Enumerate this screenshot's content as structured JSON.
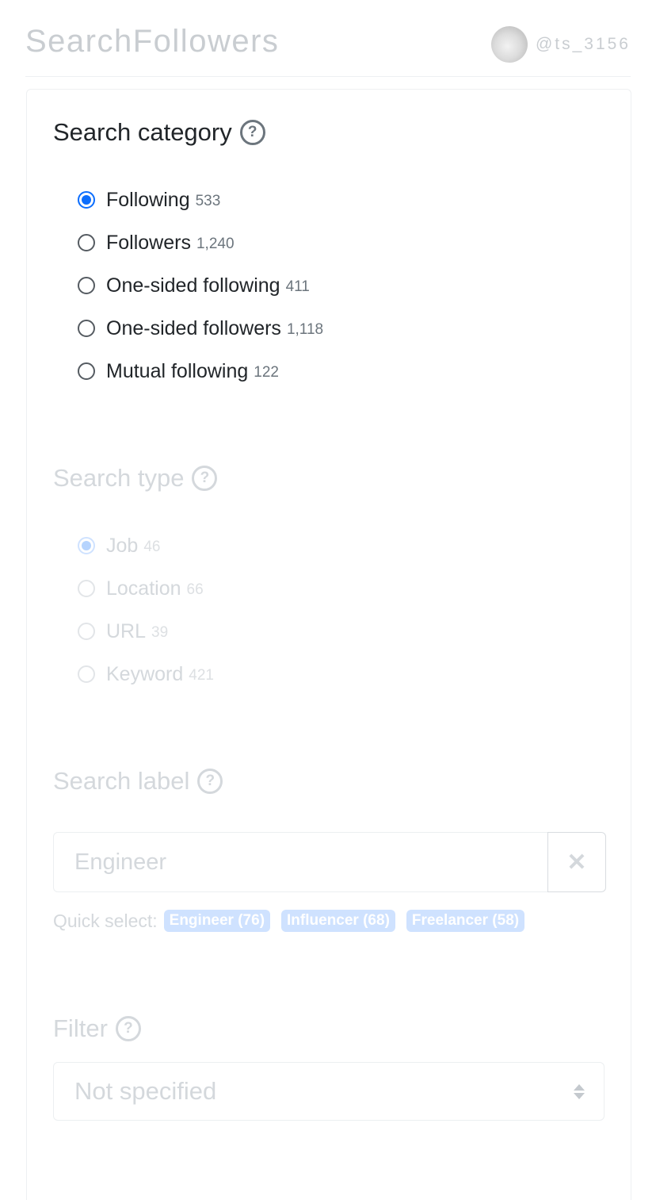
{
  "header": {
    "title": "SearchFollowers",
    "username": "@ts_3156"
  },
  "search_category": {
    "title": "Search category",
    "help": "?",
    "options": [
      {
        "label": "Following",
        "count": "533",
        "checked": true
      },
      {
        "label": "Followers",
        "count": "1,240",
        "checked": false
      },
      {
        "label": "One-sided following",
        "count": "411",
        "checked": false
      },
      {
        "label": "One-sided followers",
        "count": "1,118",
        "checked": false
      },
      {
        "label": "Mutual following",
        "count": "122",
        "checked": false
      }
    ]
  },
  "search_type": {
    "title": "Search type",
    "help": "?",
    "options": [
      {
        "label": "Job",
        "count": "46",
        "checked": true
      },
      {
        "label": "Location",
        "count": "66",
        "checked": false
      },
      {
        "label": "URL",
        "count": "39",
        "checked": false
      },
      {
        "label": "Keyword",
        "count": "421",
        "checked": false
      }
    ]
  },
  "search_label": {
    "title": "Search label",
    "help": "?",
    "value": "Engineer",
    "clear": "✕",
    "quick_select_label": "Quick select:",
    "quick_select": [
      "Engineer (76)",
      "Influencer (68)",
      "Freelancer (58)"
    ]
  },
  "filter": {
    "title": "Filter",
    "help": "?",
    "selected": "Not specified"
  },
  "colors": {
    "accent": "#0d6efd",
    "disabled_text": "#d4d8dc",
    "badge_bg": "#cfe2ff"
  }
}
